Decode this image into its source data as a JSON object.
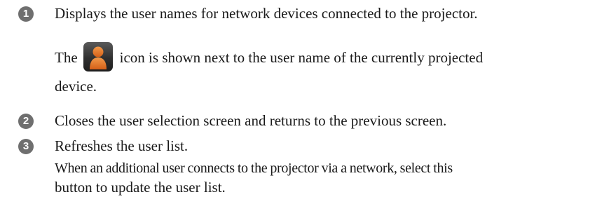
{
  "items": [
    {
      "badge": "1",
      "lines": [
        "Displays the user names for network devices connected to the projector."
      ],
      "icon_line_before": "The",
      "icon_line_after": "icon is shown next to the user name of the currently projected",
      "last_line": "device.",
      "icon": "user-person-icon",
      "icon_color": "#e8732a"
    },
    {
      "badge": "2",
      "lines": [
        "Closes the user selection screen and returns to the previous screen."
      ]
    },
    {
      "badge": "3",
      "lines": [
        "Refreshes the user list.",
        "When an additional user connects to the projector via a network, select this",
        "button to update the user list."
      ]
    }
  ],
  "colors": {
    "badge_bg": "#6f6f6f",
    "text": "#1a1a1a",
    "icon_bg": "#2f2f2f",
    "icon_person": "#e8732a"
  }
}
